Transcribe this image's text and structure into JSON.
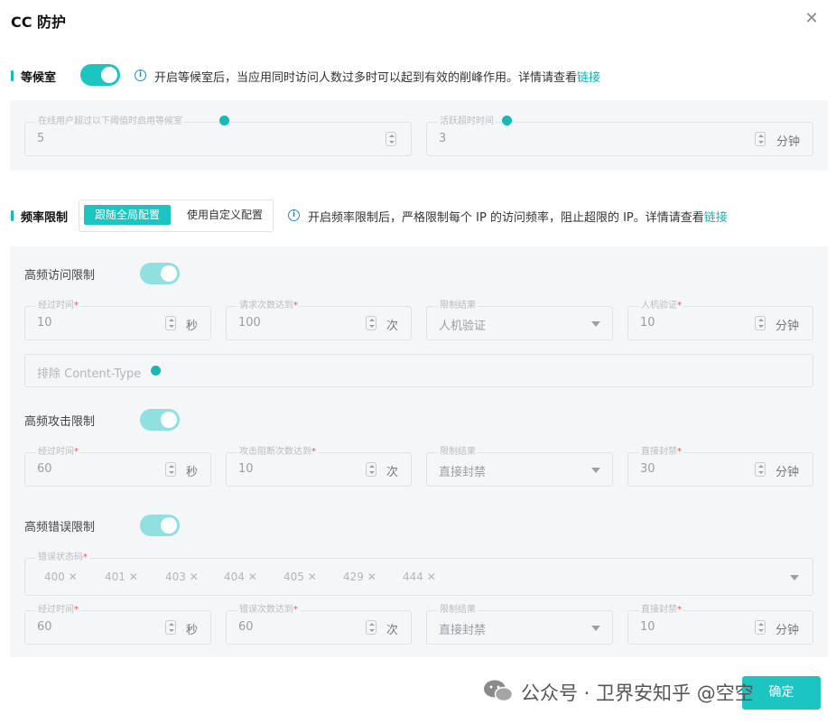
{
  "dialog": {
    "title": "CC 防护"
  },
  "waiting_room": {
    "section_label": "等候室",
    "tip": "开启等候室后，当应用同时访问人数过多时可以起到有效的削峰作用。详情请查看",
    "tip_link": "链接",
    "threshold": {
      "label": "在线用户超过以下阈值时启用等候室",
      "value": "5"
    },
    "active_timeout": {
      "label": "活跃超时时间",
      "value": "3",
      "unit": "分钟"
    }
  },
  "rate_limit": {
    "section_label": "频率限制",
    "segment": {
      "global": "跟随全局配置",
      "custom": "使用自定义配置"
    },
    "tip": "开启频率限制后，严格限制每个 IP 的访问频率，阻止超限的 IP。详情请查看",
    "tip_link": "链接",
    "high_freq_access": {
      "title": "高频访问限制",
      "elapsed": {
        "label": "经过时间",
        "value": "10",
        "unit": "秒"
      },
      "request_count": {
        "label": "请求次数达到",
        "value": "100",
        "unit": "次"
      },
      "result": {
        "label": "限制结果",
        "value": "人机验证"
      },
      "captcha": {
        "label": "人机验证",
        "value": "10",
        "unit": "分钟"
      },
      "exclude_placeholder": "排除 Content-Type"
    },
    "high_freq_attack": {
      "title": "高频攻击限制",
      "elapsed": {
        "label": "经过时间",
        "value": "60",
        "unit": "秒"
      },
      "block_count": {
        "label": "攻击阻断次数达到",
        "value": "10",
        "unit": "次"
      },
      "result": {
        "label": "限制结果",
        "value": "直接封禁"
      },
      "ban": {
        "label": "直接封禁",
        "value": "30",
        "unit": "分钟"
      }
    },
    "high_freq_error": {
      "title": "高频错误限制",
      "status_codes_label": "错误状态码",
      "status_codes": [
        "400",
        "401",
        "403",
        "404",
        "405",
        "429",
        "444"
      ],
      "elapsed": {
        "label": "经过时间",
        "value": "60",
        "unit": "秒"
      },
      "error_count": {
        "label": "错误次数达到",
        "value": "60",
        "unit": "次"
      },
      "result": {
        "label": "限制结果",
        "value": "直接封禁"
      },
      "ban": {
        "label": "直接封禁",
        "value": "10",
        "unit": "分钟"
      }
    }
  },
  "footer": {
    "watermark": "公众号 · 卫界安知乎 @空空",
    "ok_label": "确定"
  }
}
